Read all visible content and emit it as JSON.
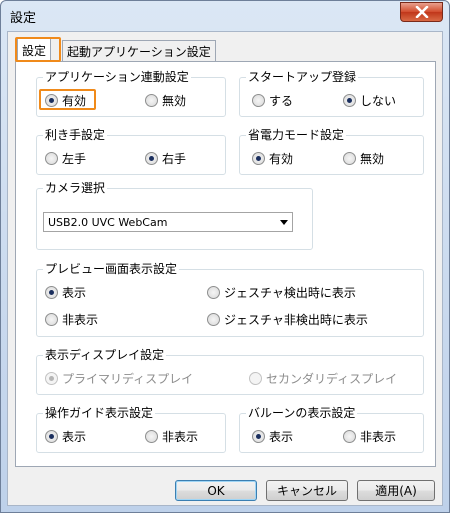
{
  "window": {
    "title": "設定"
  },
  "tabs": [
    {
      "label": "設定",
      "active": true
    },
    {
      "label": "起動アプリケーション設定",
      "active": false
    }
  ],
  "groups": {
    "app_link": {
      "title": "アプリケーション連動設定",
      "options": [
        {
          "label": "有効",
          "checked": true
        },
        {
          "label": "無効",
          "checked": false
        }
      ]
    },
    "startup": {
      "title": "スタートアップ登録",
      "options": [
        {
          "label": "する",
          "checked": false
        },
        {
          "label": "しない",
          "checked": true
        }
      ]
    },
    "handedness": {
      "title": "利き手設定",
      "options": [
        {
          "label": "左手",
          "checked": false
        },
        {
          "label": "右手",
          "checked": true
        }
      ]
    },
    "power_mode": {
      "title": "省電力モード設定",
      "options": [
        {
          "label": "有効",
          "checked": true
        },
        {
          "label": "無効",
          "checked": false
        }
      ]
    },
    "camera": {
      "title": "カメラ選択",
      "selected": "USB2.0 UVC WebCam"
    },
    "preview": {
      "title": "プレビュー画面表示設定",
      "options": [
        {
          "label": "表示",
          "checked": true
        },
        {
          "label": "ジェスチャ検出時に表示",
          "checked": false
        },
        {
          "label": "非表示",
          "checked": false
        },
        {
          "label": "ジェスチャ非検出時に表示",
          "checked": false
        }
      ]
    },
    "display": {
      "title": "表示ディスプレイ設定",
      "options": [
        {
          "label": "プライマリディスプレイ",
          "checked": true
        },
        {
          "label": "セカンダリディスプレイ",
          "checked": false
        }
      ]
    },
    "guide": {
      "title": "操作ガイド表示設定",
      "options": [
        {
          "label": "表示",
          "checked": true
        },
        {
          "label": "非表示",
          "checked": false
        }
      ]
    },
    "balloon": {
      "title": "バルーンの表示設定",
      "options": [
        {
          "label": "表示",
          "checked": true
        },
        {
          "label": "非表示",
          "checked": false
        }
      ]
    }
  },
  "buttons": {
    "ok": "OK",
    "cancel": "キャンセル",
    "apply": "適用(A)"
  },
  "colors": {
    "focus_highlight": "#f08a1a",
    "close_button": "#c0361a"
  },
  "icons": {
    "close": "close-icon"
  }
}
